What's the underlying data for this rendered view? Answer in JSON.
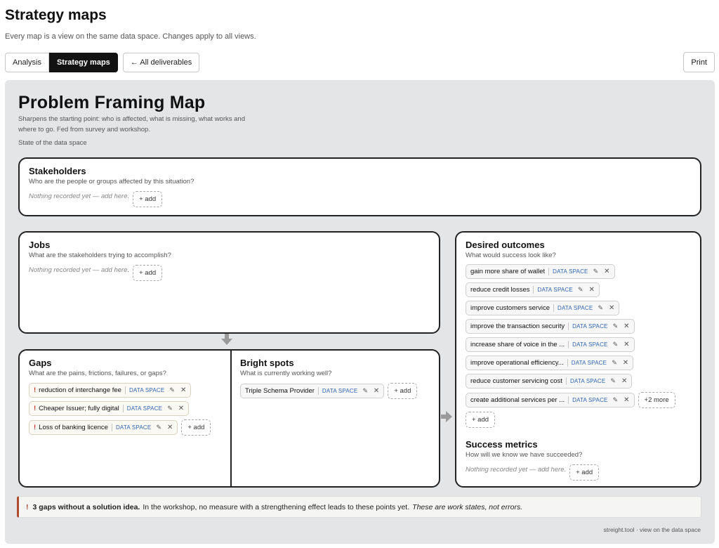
{
  "header": {
    "title": "Strategy maps",
    "subtitle": "Every map is a view on the same data space. Changes apply to all views."
  },
  "tabs": [
    {
      "label": "Analysis"
    },
    {
      "label": "Strategy maps",
      "active": true
    },
    {
      "label": "← All deliverables"
    }
  ],
  "print_label": "Print",
  "map": {
    "title": "Problem Framing Map",
    "description": "Sharpens the starting point: who is affected, what is missing, what works and where to go. Fed from survey and workshop.",
    "state": "State of the data space"
  },
  "common": {
    "empty_text": "Nothing recorded yet — add here.",
    "add_label": "+ add",
    "data_space_tag": "DATA SPACE"
  },
  "sections": {
    "stakeholders": {
      "title": "Stakeholders",
      "question": "Who are the people or groups affected by this situation?"
    },
    "jobs": {
      "title": "Jobs",
      "question": "What are the stakeholders trying to accomplish?"
    },
    "gaps": {
      "title": "Gaps",
      "question": "What are the pains, frictions, failures, or gaps?",
      "items": [
        "reduction of interchange fee",
        "Cheaper Issuer; fully digital",
        "Loss of banking licence"
      ]
    },
    "bright_spots": {
      "title": "Bright spots",
      "question": "What is currently working well?",
      "items": [
        "Triple Schema Provider"
      ]
    },
    "desired_outcomes": {
      "title": "Desired outcomes",
      "question": "What would success look like?",
      "items": [
        "gain more share of wallet",
        "reduce credit losses",
        "improve customers service",
        "improve the transaction security",
        "increase share of voice in the ...",
        "improve operational efficiency...",
        "reduce customer servicing cost",
        "create additional services per ..."
      ],
      "more_label": "+2 more"
    },
    "success_metrics": {
      "title": "Success metrics",
      "question": "How will we know we have succeeded?"
    }
  },
  "notice": {
    "bold": "3 gaps without a solution idea.",
    "text": "In the workshop, no measure with a strengthening effect leads to these points yet.",
    "italic": "These are work states, not errors."
  },
  "footer": "streight.tool · view on the data space",
  "colors": {
    "accent_dark": "#121212",
    "data_space_blue": "#2f64b0",
    "warning": "#b04a2c"
  }
}
